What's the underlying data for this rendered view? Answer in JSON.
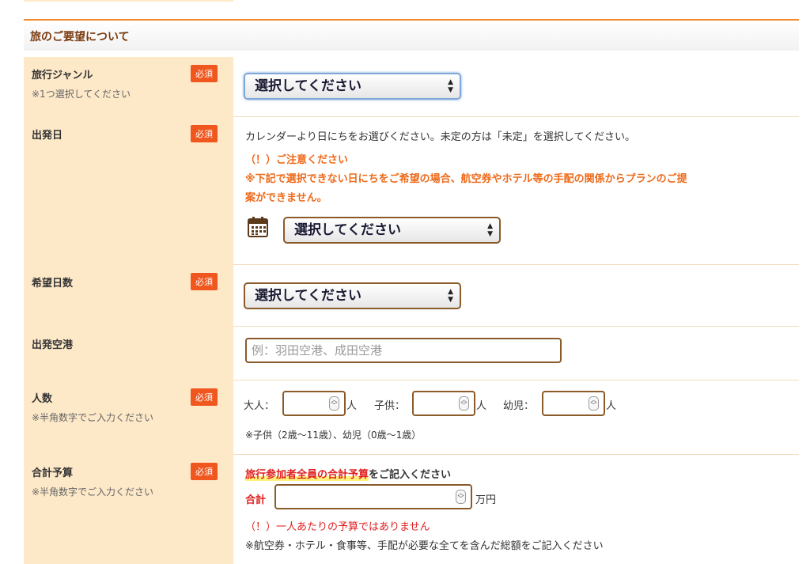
{
  "section": {
    "title": "旅のご要望について"
  },
  "rows": {
    "genre": {
      "label": "旅行ジャンル",
      "note": "※1つ選択してください",
      "badge": "必須",
      "select_value": "選択してください"
    },
    "departure_date": {
      "label": "出発日",
      "badge": "必須",
      "instruction": "カレンダーより日にちをお選びください。未定の方は「未定」を選択してください。",
      "caution_title": "（！）ご注意ください",
      "caution_line1": "※下記で選択できない日にちをご希望の場合、航空券やホテル等の手配の関係からプランのご提",
      "caution_line2": "案ができません。",
      "select_value": "選択してください",
      "calendar_icon": "calendar-icon"
    },
    "days": {
      "label": "希望日数",
      "badge": "必須",
      "select_value": "選択してください"
    },
    "airport": {
      "label": "出発空港",
      "placeholder": "例：羽田空港、成田空港"
    },
    "people": {
      "label": "人数",
      "note": "※半角数字でご入力ください",
      "badge": "必須",
      "adult_label": "大人：",
      "child_label": "子供：",
      "infant_label": "幼児：",
      "unit": "人",
      "age_note": "※子供（2歳〜11歳）、幼児（0歳〜1歳）"
    },
    "budget": {
      "label": "合計予算",
      "note": "※半角数字でご入力ください",
      "badge": "必須",
      "heading_highlight": "旅行参加者全員の合計予算",
      "heading_rest": "をご記入ください",
      "total_label": "合計",
      "unit": "万円",
      "warning": "（！）一人あたりの予算ではありません",
      "footnote": "※航空券・ホテル・食事等、手配が必要な全てを含んだ総額をご記入ください"
    }
  },
  "colors": {
    "accent": "#f08a2c",
    "badge": "#f0571f",
    "label_bg": "#fde8c8",
    "input_border": "#8b5a2b",
    "warning": "#ee6a1a"
  }
}
